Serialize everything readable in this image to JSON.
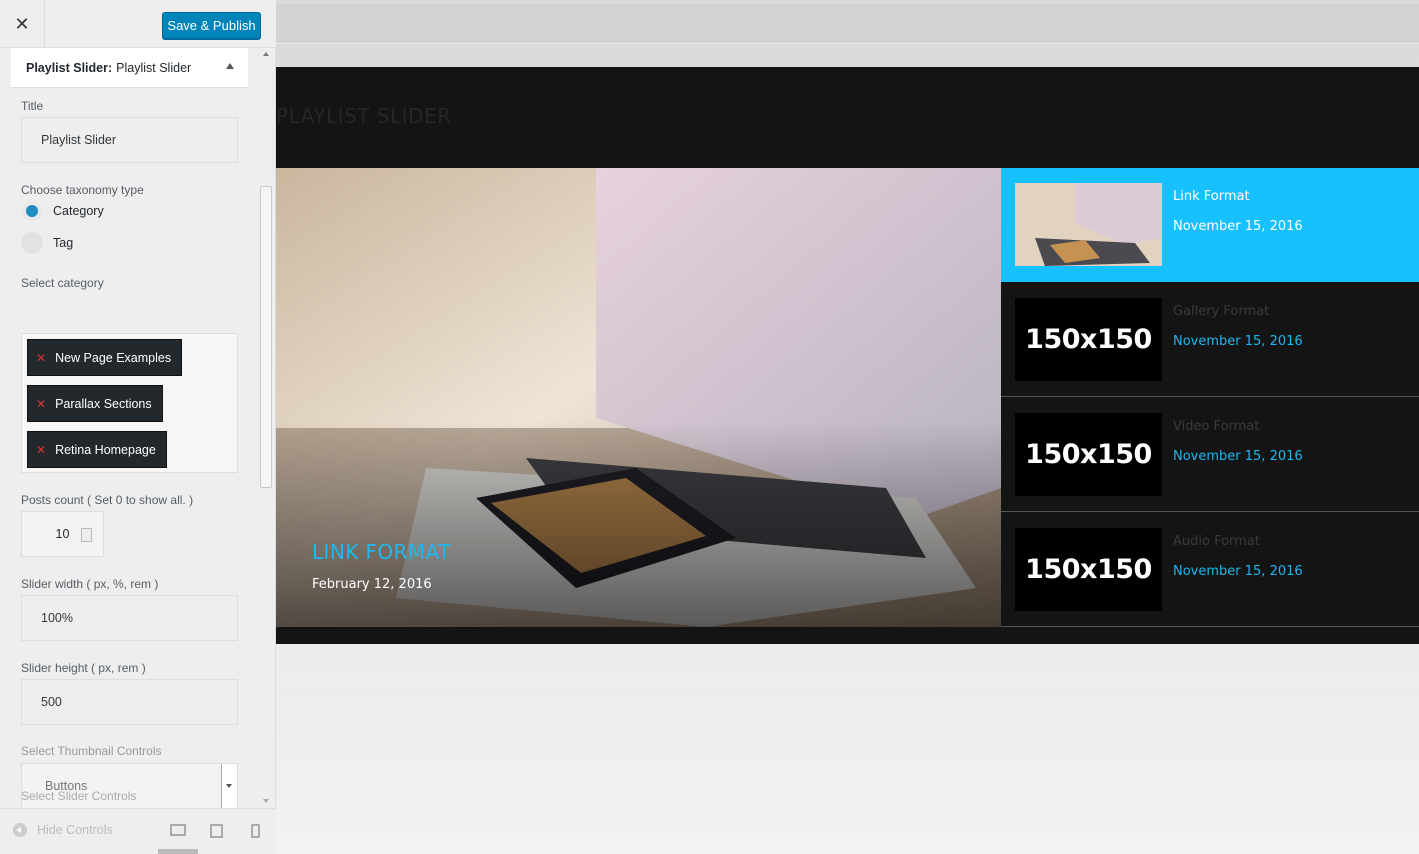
{
  "customizer": {
    "close_glyph": "✕",
    "publish_label": "Save & Publish",
    "section": {
      "prefix": "Playlist Slider:",
      "name": "Playlist Slider"
    },
    "fields": {
      "title_label": "Title",
      "title_value": "Playlist Slider",
      "taxonomy_label": "Choose taxonomy type",
      "taxonomy_options": [
        {
          "label": "Category",
          "checked": true
        },
        {
          "label": "Tag",
          "checked": false
        }
      ],
      "category_label": "Select category",
      "categories": [
        "New Page Examples",
        "Parallax Sections",
        "Retina Homepage"
      ],
      "posts_count_label": "Posts count ( Set 0 to show all. )",
      "posts_count_value": "10",
      "width_label": "Slider width ( px, %, rem )",
      "width_value": "100%",
      "height_label": "Slider height ( px, rem )",
      "height_value": "500",
      "thumb_controls_label": "Select Thumbnail Controls",
      "thumb_controls_value": "Buttons",
      "slider_controls_label": "Select Slider Controls"
    },
    "footer": {
      "hide_controls": "Hide Controls"
    }
  },
  "preview": {
    "slider_title": "PLAYLIST SLIDER",
    "hero": {
      "title": "LINK FORMAT",
      "date": "February 12, 2016"
    },
    "playlist": [
      {
        "title": "Link Format",
        "date": "November 15, 2016",
        "thumb": "",
        "active": true
      },
      {
        "title": "Gallery Format",
        "date": "November 15, 2016",
        "thumb": "150x150",
        "active": false
      },
      {
        "title": "Video Format",
        "date": "November 15, 2016",
        "thumb": "150x150",
        "active": false
      },
      {
        "title": "Audio Format",
        "date": "November 15, 2016",
        "thumb": "150x150",
        "active": false
      }
    ]
  },
  "colors": {
    "primary_button": "#0085ba",
    "accent": "#1fb7f0",
    "active_item": "#17c0ff",
    "tag_bg": "#23282d",
    "tag_remove": "#dc3232"
  },
  "icons": {
    "close": "close-icon",
    "collapse": "triangle-up-icon",
    "tag_remove": "remove-x-icon",
    "hide_controls": "arrow-left-circle-icon",
    "desktop": "desktop-icon",
    "tablet": "tablet-icon",
    "mobile": "mobile-icon"
  }
}
